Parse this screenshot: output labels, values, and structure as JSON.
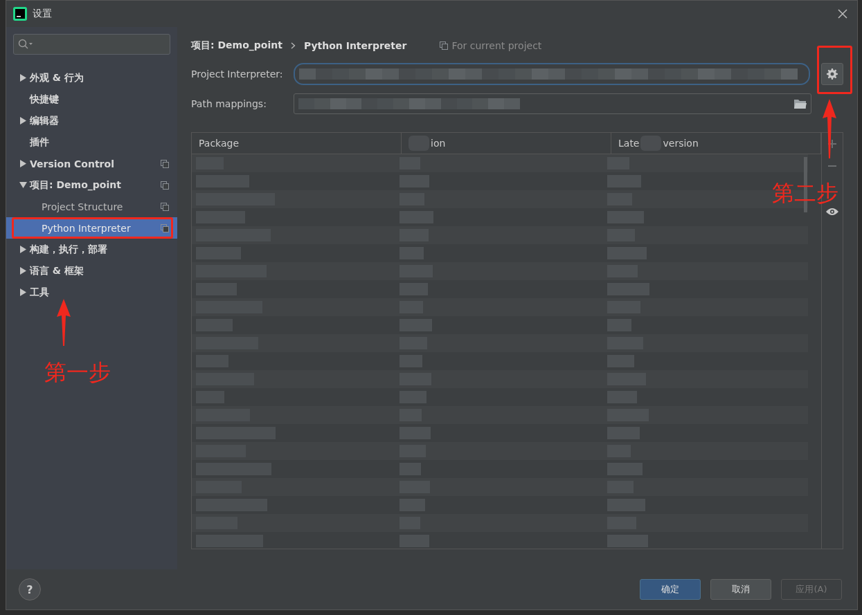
{
  "window": {
    "title": "设置"
  },
  "sidebar": {
    "items": [
      {
        "label": "外观 & 行为",
        "expanded": false,
        "selected": false,
        "project_scoped": false
      },
      {
        "label": "快捷键",
        "selected": false,
        "project_scoped": false
      },
      {
        "label": "编辑器",
        "expanded": false,
        "selected": false,
        "project_scoped": false
      },
      {
        "label": "插件",
        "selected": false,
        "project_scoped": false
      },
      {
        "label": "Version Control",
        "expanded": false,
        "selected": false,
        "project_scoped": true
      },
      {
        "label": "项目: Demo_point",
        "expanded": true,
        "selected": false,
        "project_scoped": true,
        "children": [
          {
            "label": "Project Structure",
            "selected": false,
            "project_scoped": true
          },
          {
            "label": "Python Interpreter",
            "selected": true,
            "project_scoped": true
          }
        ]
      },
      {
        "label": "构建，执行，部署",
        "expanded": false,
        "selected": false,
        "project_scoped": false
      },
      {
        "label": "语言 & 框架",
        "expanded": false,
        "selected": false,
        "project_scoped": false
      },
      {
        "label": "工具",
        "expanded": false,
        "selected": false,
        "project_scoped": false
      }
    ]
  },
  "breadcrumb": {
    "items": [
      "项目: Demo_point",
      "Python Interpreter"
    ],
    "scope": "For current project"
  },
  "fields": [
    {
      "label": "Project Interpreter:",
      "kind": "dropdown",
      "focused": true
    },
    {
      "label": "Path mappings:",
      "kind": "folder"
    }
  ],
  "table": {
    "columns": [
      {
        "parts": [
          {
            "kind": "text",
            "text": "Package"
          }
        ]
      },
      {
        "parts": [
          {
            "kind": "blur"
          },
          {
            "kind": "text",
            "text": "ion"
          }
        ]
      },
      {
        "parts": [
          {
            "kind": "text",
            "text": "Late"
          },
          {
            "kind": "blur"
          },
          {
            "kind": "text",
            "text": "version"
          }
        ]
      }
    ]
  },
  "help": "?",
  "buttons": [
    {
      "label": "确定",
      "kind": "default",
      "disabled": false
    },
    {
      "label": "取消",
      "kind": "normal",
      "disabled": false
    },
    {
      "label": "应用(A)",
      "kind": "normal",
      "disabled": true
    }
  ],
  "annotations": [
    {
      "text": "第一步"
    },
    {
      "text": "第二步"
    }
  ]
}
